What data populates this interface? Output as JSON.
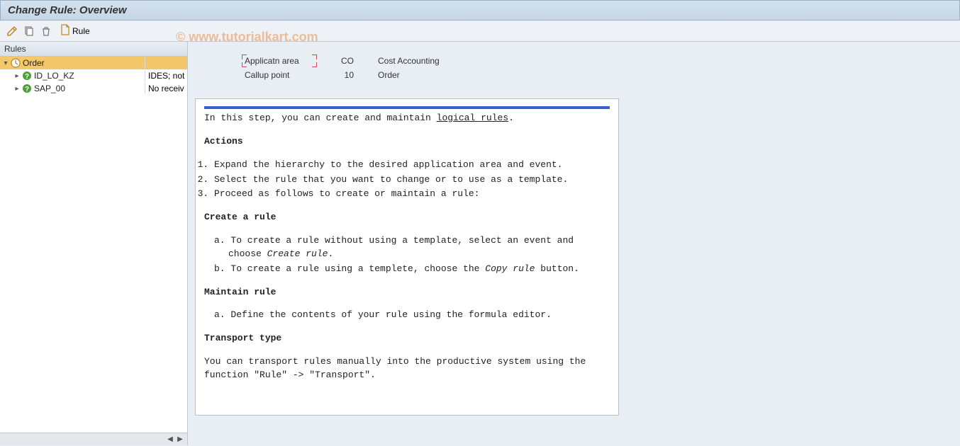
{
  "title": "Change Rule: Overview",
  "watermark": "© www.tutorialkart.com",
  "toolbar": {
    "rule_label": "Rule"
  },
  "tree": {
    "header": "Rules",
    "root": {
      "label": "Order",
      "col2": ""
    },
    "items": [
      {
        "label": "ID_LO_KZ",
        "col2": "IDES; not"
      },
      {
        "label": "SAP_00",
        "col2": "No receiv"
      }
    ]
  },
  "form": {
    "app_label": "Applicatn area",
    "app_value": "CO",
    "app_desc": "Cost Accounting",
    "callup_label": "Callup point",
    "callup_value": "10",
    "callup_desc": "Order"
  },
  "doc": {
    "intro_pre": "In this step, you can create and maintain ",
    "intro_link": "logical rules",
    "intro_post": ".",
    "h_actions": "Actions",
    "a1": "Expand the hierarchy to the desired application area and event.",
    "a2": "Select the rule that you want to change or to use as a template.",
    "a3": "Proceed as follows to create or maintain a rule:",
    "h_create": "Create a rule",
    "c_a_pre": "a. To create a rule without using a template, select an event and choose ",
    "c_a_i": "Create rule",
    "c_a_post": ".",
    "c_b_pre": "b. To create a rule using a templete, choose the ",
    "c_b_i": "Copy rule",
    "c_b_post": " button.",
    "h_maintain": "Maintain rule",
    "m_a": "a. Define the contents of your rule using the formula editor.",
    "h_transport": "Transport type",
    "t_text": "You can transport rules manually into the productive system using the function \"Rule\" -> \"Transport\"."
  }
}
